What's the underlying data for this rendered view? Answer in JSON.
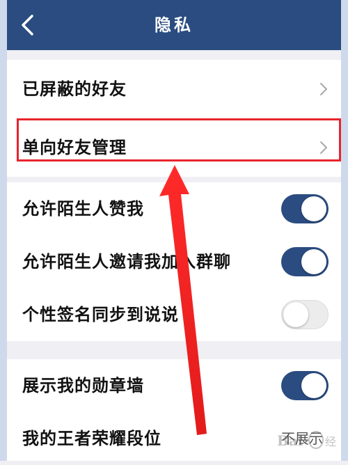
{
  "header": {
    "title": "隐私",
    "back_icon": "chevron-left-icon",
    "background_color": "#2a4c80"
  },
  "groups": [
    {
      "items": [
        {
          "label": "已屏蔽的好友",
          "type": "link"
        },
        {
          "label": "单向好友管理",
          "type": "link"
        }
      ]
    },
    {
      "items": [
        {
          "label": "允许陌生人赞我",
          "type": "toggle",
          "enabled": true
        },
        {
          "label": "允许陌生人邀请我加入群聊",
          "type": "toggle",
          "enabled": true
        },
        {
          "label": "个性签名同步到说说",
          "type": "toggle",
          "enabled": false
        }
      ]
    },
    {
      "items": [
        {
          "label": "展示我的勋章墙",
          "type": "toggle",
          "enabled": true
        },
        {
          "label": "我的王者荣耀段位",
          "type": "value",
          "value": "不展示"
        }
      ]
    }
  ],
  "annotation": {
    "highlight_color": "#e8242c",
    "highlighted_item": "单向好友管理"
  },
  "colors": {
    "accent": "#2a4c80",
    "toggle_off": "#ececec",
    "page_background": "#efeff4"
  }
}
